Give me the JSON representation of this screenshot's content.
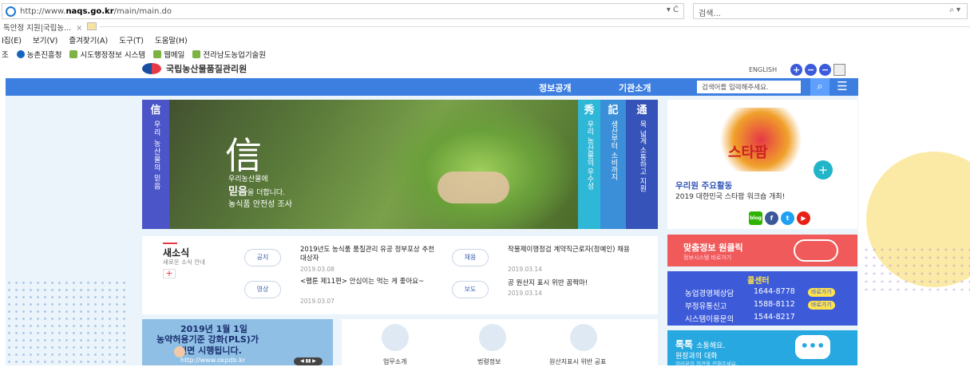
{
  "browser": {
    "url_prefix": "http://www.",
    "url_domain": "naqs.go.kr",
    "url_path": "/main/main.do",
    "address_controls": "▾ Ċ",
    "search_placeholder": "검색...",
    "search_icon": "⌕ ▾",
    "tab_title": "독안정 지원|국립농...",
    "tab_close": "×",
    "menu": [
      "I집(E)",
      "보기(V)",
      "즐겨찾기(A)",
      "도구(T)",
      "도움말(H)"
    ],
    "favorites_prefix": "조",
    "favorites": [
      "농촌진흥청",
      "시도행정정보 시스템",
      "웹메일",
      "전라남도농업기술원"
    ]
  },
  "site": {
    "logo_text": "국립농산물품질관리원",
    "english_link": "ENGLISH",
    "nav_items": [
      "정보공개",
      "기관소개"
    ],
    "search_placeholder": "검색어를 입력해주세요.",
    "search_icon": "⌕",
    "menu_icon": "☰"
  },
  "hero": {
    "vertical_head": "信",
    "vertical_text": "우리 농산물의 믿음",
    "big_char": "信",
    "line1": "우리농산물에",
    "line2_bold": "믿음",
    "line2_rest": "을 더합니다.",
    "line3": "농식품 안전성 조사"
  },
  "side_columns": [
    {
      "head": "秀",
      "text": "우리 농산물의 우수성",
      "color": "#2fb7d8"
    },
    {
      "head": "記",
      "text": "생산부터 소비까지",
      "color": "#3a8fd8"
    },
    {
      "head": "通",
      "text": "목 넓게 소통하고 지원",
      "color": "#3553b8"
    }
  ],
  "promo": {
    "star_text": "스타팜",
    "plus": "+",
    "label": "우리원 주요활동",
    "subtitle": "2019 대한민국 스타팜 워크숍 개최!",
    "sns": [
      "blog",
      "f",
      "t",
      "▶"
    ]
  },
  "news": {
    "title": "새소식",
    "subtitle": "새로운 소식 안내",
    "more": "+",
    "items": [
      {
        "tag": "공지",
        "text": "2019년도 농식품 품질관리 유공 정부포상 추천대상자",
        "date": "2019.03.08"
      },
      {
        "tag": "채용",
        "text": "작물제이행정검 계약직근로자(정예인) 채용",
        "date": "2019.03.14"
      },
      {
        "tag": "영상",
        "text": "<팸툰 제11편> 안심이는 먹는 게 좋아요~",
        "date": "2019.03.07"
      },
      {
        "tag": "보도",
        "text": "공 원산지 표시 위반 꼼짝마!",
        "date": "2019.03.14"
      }
    ]
  },
  "banner": {
    "line1": "2019년 1월 1일",
    "line2": "농약허용기준 강화(PLS)가",
    "line3": "전면 시행됩니다.",
    "url": "http://www.okpdb.kr",
    "control": "◀ ▮▮ ▶"
  },
  "quick_icons": [
    {
      "label": "업무소개",
      "icon": "briefcase-icon"
    },
    {
      "label": "법령정보",
      "icon": "gavel-icon"
    },
    {
      "label": "원산지표시 위반 공표",
      "icon": "document-icon"
    }
  ],
  "quick_link": {
    "title": "맞춤정보 원클릭",
    "subtitle": "정보시스템 바로가기"
  },
  "call_center": {
    "title": "콜센터",
    "rows": [
      {
        "label": "농업경영체상담",
        "number": "1644-8778",
        "button": "바로가기"
      },
      {
        "label": "부정유통신고",
        "number": "1588-8112",
        "button": "바로가기"
      },
      {
        "label": "시스템이용문의",
        "number": "1544-8217",
        "button": ""
      }
    ]
  },
  "talk": {
    "title": "톡톡",
    "title_suffix": "소통해요.",
    "line": "원장과의 대화",
    "small": "여러분의 의견을 전해주세요.",
    "bubble": "•••"
  }
}
